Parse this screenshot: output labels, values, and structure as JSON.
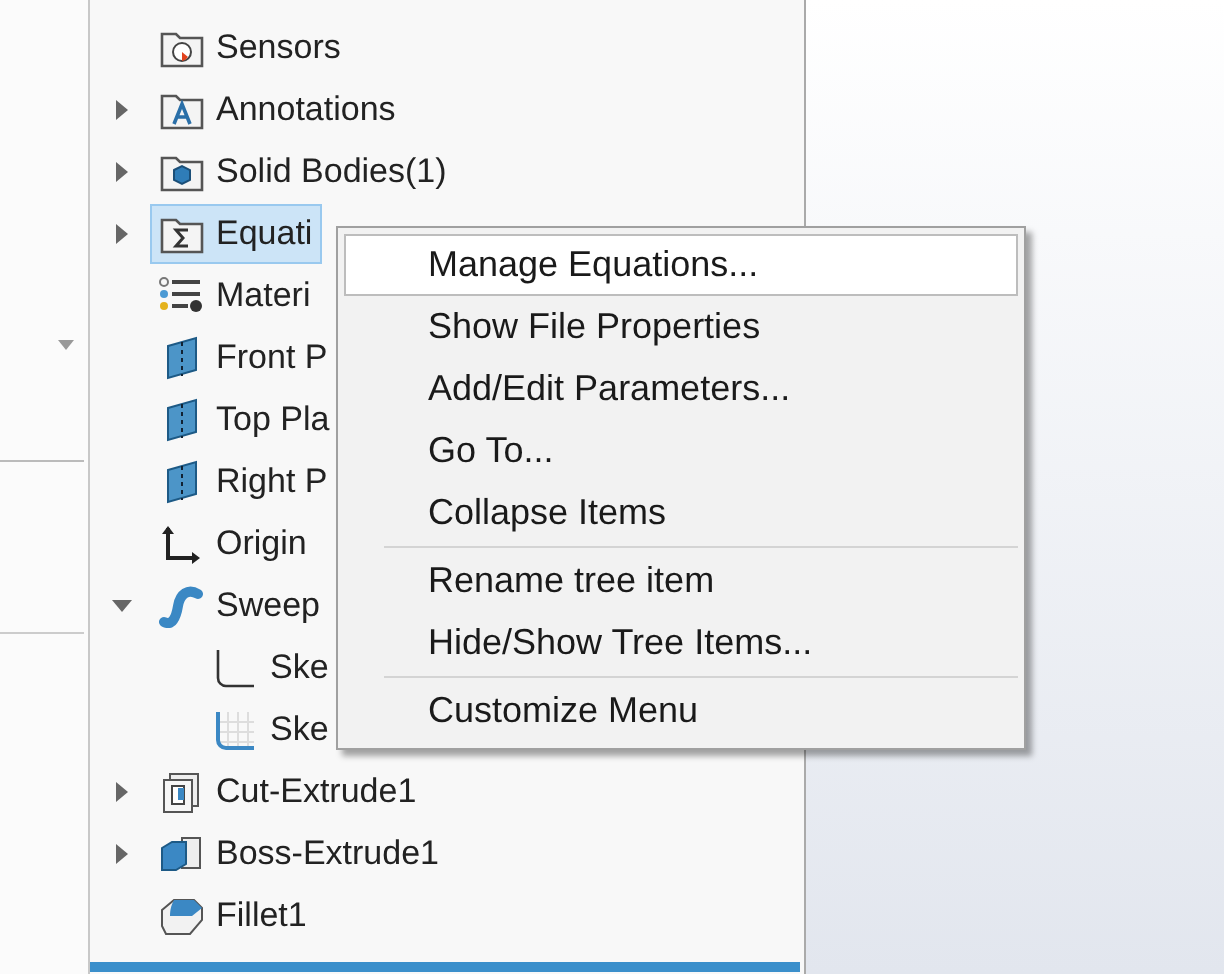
{
  "tree": {
    "items": [
      {
        "label": "Sensors",
        "kind": "sensors",
        "selected": false
      },
      {
        "label": "Annotations",
        "kind": "annotations",
        "expanded": false,
        "selected": false
      },
      {
        "label": "Solid Bodies(1)",
        "kind": "bodies",
        "expanded": false,
        "selected": false
      },
      {
        "label": "Equati",
        "kind": "equations",
        "expanded": false,
        "selected": true
      },
      {
        "label": "Materi",
        "kind": "material",
        "selected": false
      },
      {
        "label": "Front P",
        "kind": "plane",
        "selected": false
      },
      {
        "label": "Top Pla",
        "kind": "plane",
        "selected": false
      },
      {
        "label": "Right P",
        "kind": "plane",
        "selected": false
      },
      {
        "label": "Origin",
        "kind": "origin",
        "selected": false
      },
      {
        "label": "Sweep",
        "kind": "sweep",
        "expanded": true,
        "selected": false,
        "children": [
          {
            "label": "Ske",
            "kind": "sketch",
            "selected": false
          },
          {
            "label": "Ske",
            "kind": "sketch3d",
            "selected": false
          }
        ]
      },
      {
        "label": "Cut-Extrude1",
        "kind": "cut",
        "expanded": false,
        "selected": false
      },
      {
        "label": "Boss-Extrude1",
        "kind": "boss",
        "expanded": false,
        "selected": false
      },
      {
        "label": "Fillet1",
        "kind": "fillet",
        "selected": false
      }
    ]
  },
  "context_menu": {
    "groups": [
      [
        {
          "label": "Manage Equations...",
          "selected": true
        },
        {
          "label": "Show File Properties",
          "selected": false
        },
        {
          "label": "Add/Edit Parameters...",
          "selected": false
        },
        {
          "label": "Go To...",
          "selected": false
        },
        {
          "label": "Collapse Items",
          "selected": false
        }
      ],
      [
        {
          "label": "Rename tree item",
          "selected": false
        },
        {
          "label": "Hide/Show Tree Items...",
          "selected": false
        }
      ],
      [
        {
          "label": "Customize Menu",
          "selected": false
        }
      ]
    ]
  }
}
